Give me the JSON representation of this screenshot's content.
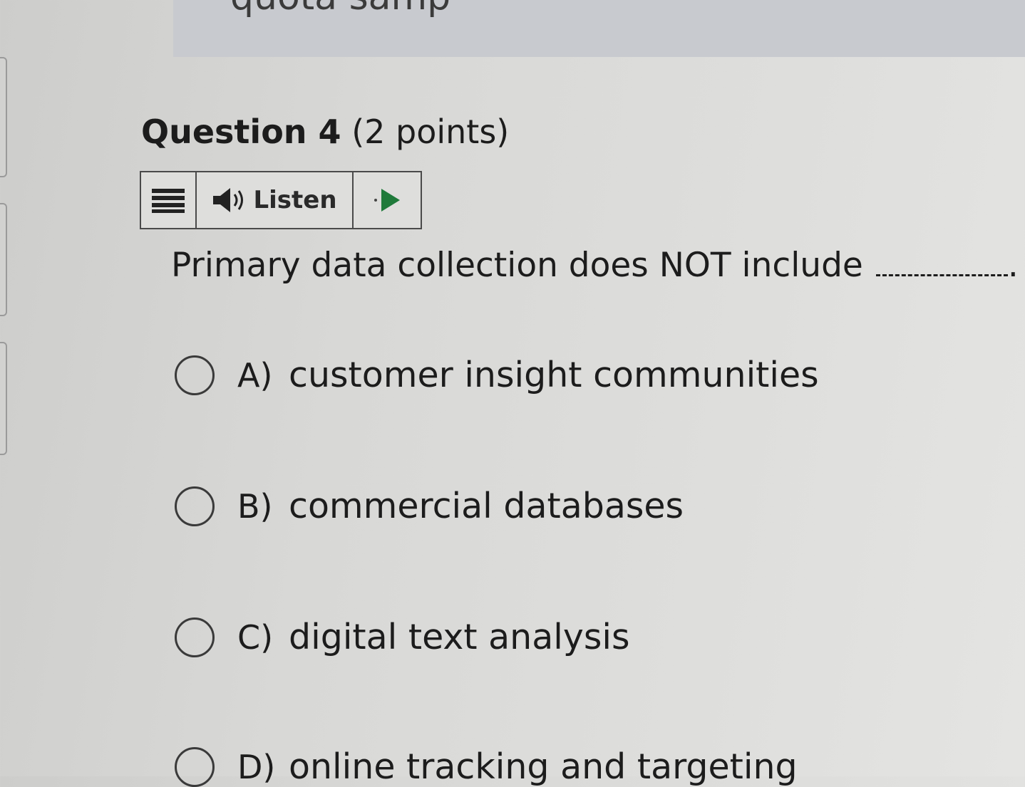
{
  "prev_question": {
    "partial_text": "quota samp"
  },
  "question": {
    "title_number": "Question 4",
    "title_points": "(2 points)",
    "prompt": "Primary data collection does NOT include",
    "prompt_end": "."
  },
  "toolbar": {
    "menu_icon": "hamburger-icon",
    "listen_label": "Listen",
    "speaker_icon": "speaker-icon",
    "play_icon": "play-icon",
    "play_color": "#1f7a3a"
  },
  "options": [
    {
      "letter": "A)",
      "text": "customer insight communities"
    },
    {
      "letter": "B)",
      "text": "commercial databases"
    },
    {
      "letter": "C)",
      "text": "digital text analysis"
    },
    {
      "letter": "D)",
      "text": "online tracking and targeting"
    }
  ]
}
